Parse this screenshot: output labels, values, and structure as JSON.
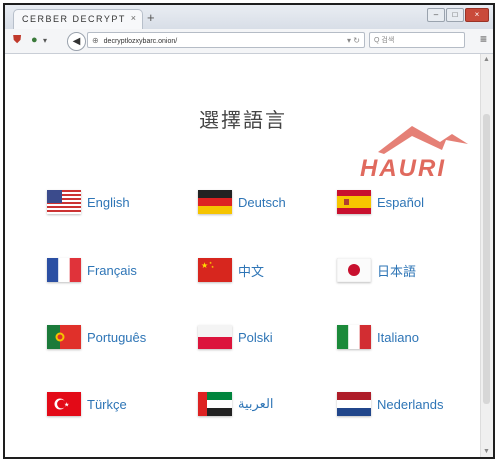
{
  "browser": {
    "tab_title": "CERBER DECRYPT",
    "tab_close": "×",
    "new_tab": "+",
    "url": "decryptlozxybarc.onion/",
    "search_placeholder": "Q 검색",
    "window_buttons": [
      "‒",
      "□",
      "×"
    ]
  },
  "page": {
    "title": "選擇語言",
    "watermark": "HAURI"
  },
  "languages": [
    {
      "label": "English",
      "flag": "us-flag-icon"
    },
    {
      "label": "Deutsch",
      "flag": "de-flag-icon"
    },
    {
      "label": "Español",
      "flag": "es-flag-icon"
    },
    {
      "label": "Français",
      "flag": "fr-flag-icon"
    },
    {
      "label": "中文",
      "flag": "cn-flag-icon"
    },
    {
      "label": "日本語",
      "flag": "jp-flag-icon"
    },
    {
      "label": "Português",
      "flag": "pt-flag-icon"
    },
    {
      "label": "Polski",
      "flag": "pl-flag-icon"
    },
    {
      "label": "Italiano",
      "flag": "it-flag-icon"
    },
    {
      "label": "Türkçe",
      "flag": "tr-flag-icon"
    },
    {
      "label": "العربية",
      "flag": "ae-flag-icon"
    },
    {
      "label": "Nederlands",
      "flag": "nl-flag-icon"
    }
  ],
  "colors": {
    "link": "#2e75b6",
    "watermark": "#e06a5e"
  }
}
